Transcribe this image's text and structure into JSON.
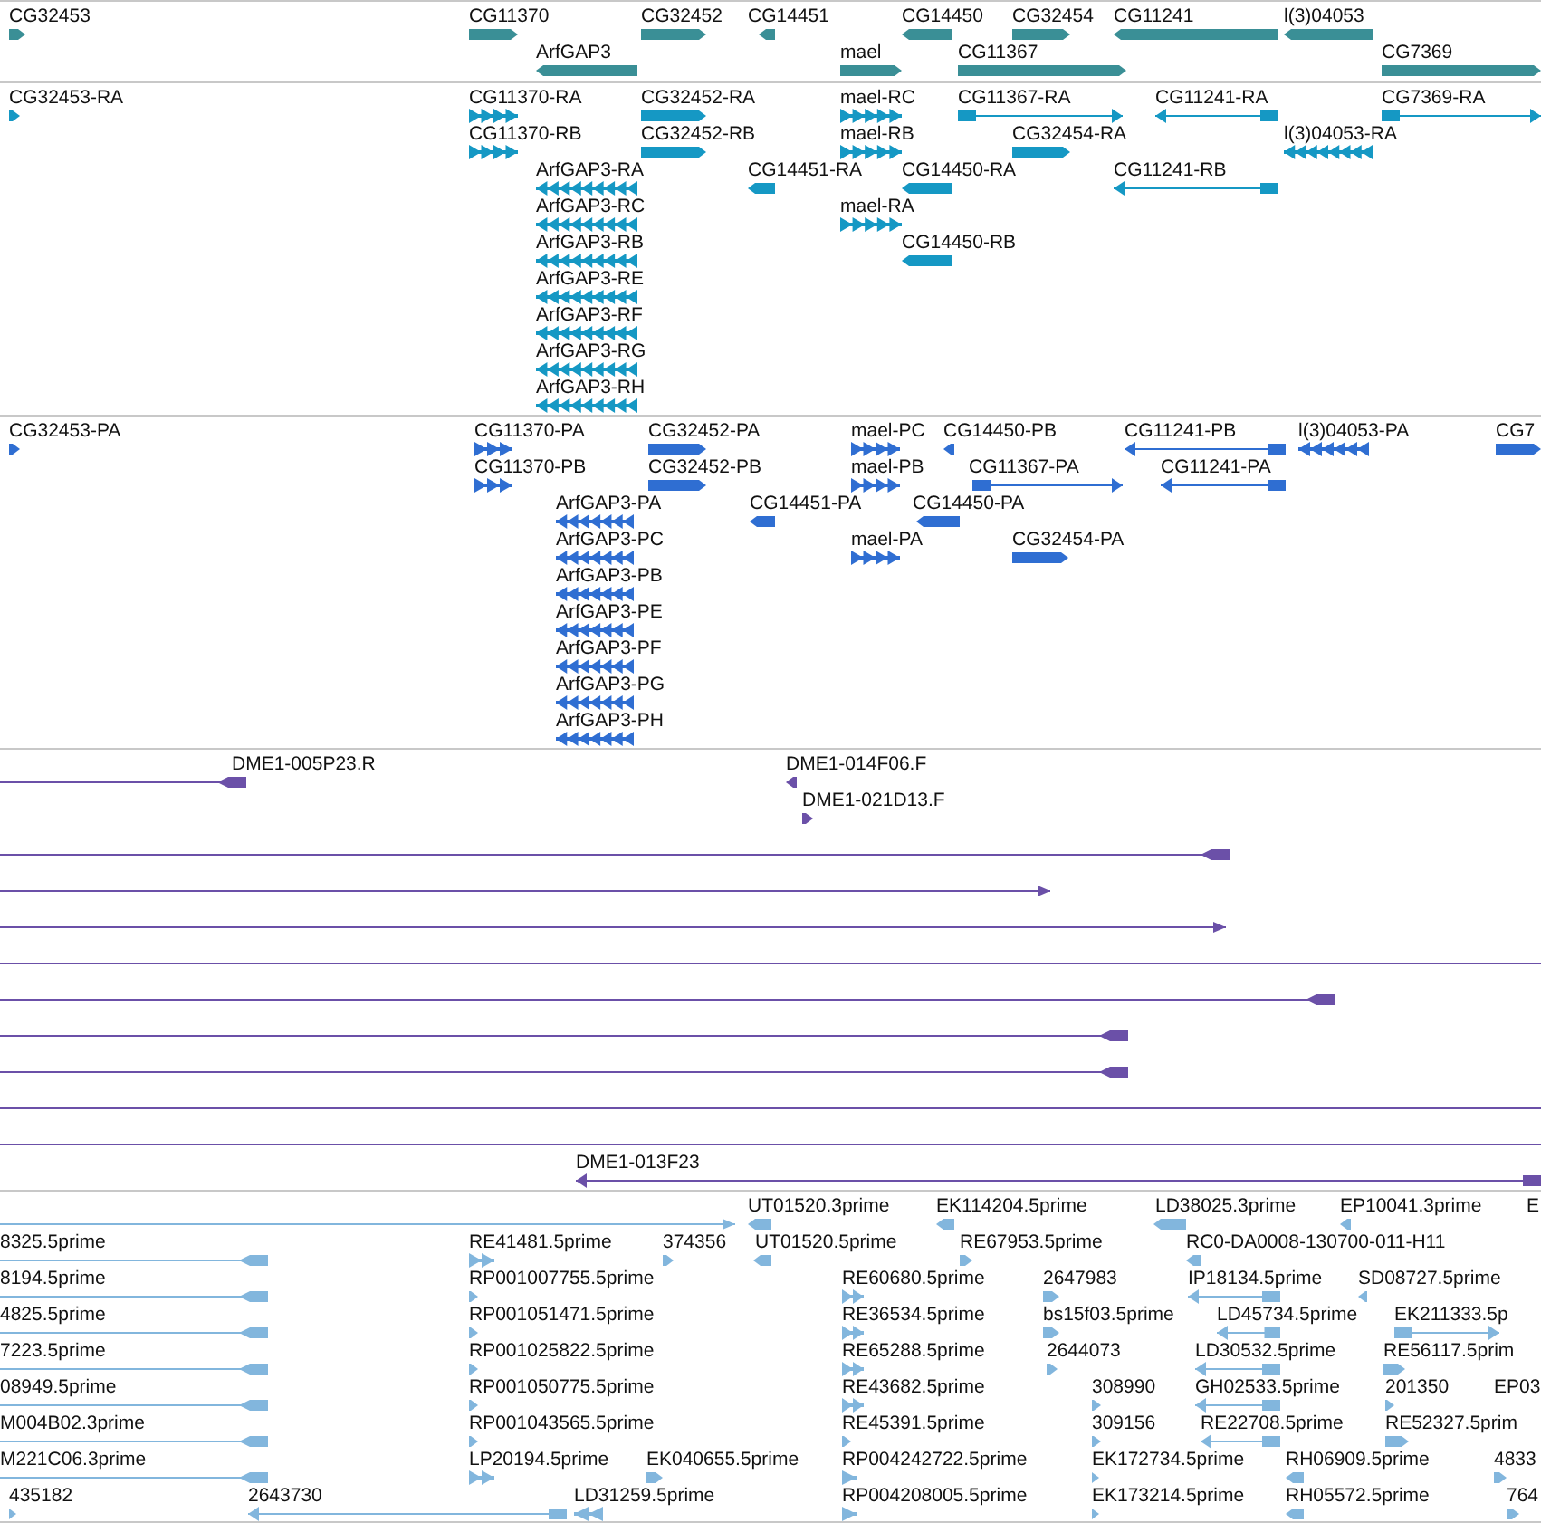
{
  "tracks": [
    {
      "color": "#3a8f96",
      "features": [
        {
          "label": "CG32453",
          "reverse": false
        },
        {
          "label": "CG11370",
          "reverse": false
        },
        {
          "label": "CG32452",
          "reverse": false
        },
        {
          "label": "CG14451",
          "reverse": true
        },
        {
          "label": "CG14450",
          "reverse": true
        },
        {
          "label": "CG32454",
          "reverse": false
        },
        {
          "label": "CG11241",
          "reverse": true
        },
        {
          "label": "l(3)04053",
          "reverse": true
        },
        {
          "label": "ArfGAP3",
          "reverse": true
        },
        {
          "label": "mael",
          "reverse": false
        },
        {
          "label": "CG11367",
          "reverse": false
        },
        {
          "label": "CG7369",
          "reverse": false
        }
      ]
    },
    {
      "color": "#1598c4",
      "features": [
        {
          "label": "CG32453-RA",
          "reverse": false
        },
        {
          "label": "CG11370-RA",
          "reverse": false
        },
        {
          "label": "CG32452-RA",
          "reverse": false
        },
        {
          "label": "mael-RC",
          "reverse": false
        },
        {
          "label": "CG11367-RA",
          "reverse": false
        },
        {
          "label": "CG11241-RA",
          "reverse": true
        },
        {
          "label": "CG7369-RA",
          "reverse": false
        },
        {
          "label": "CG11370-RB",
          "reverse": false
        },
        {
          "label": "CG32452-RB",
          "reverse": false
        },
        {
          "label": "mael-RB",
          "reverse": false
        },
        {
          "label": "CG32454-RA",
          "reverse": false
        },
        {
          "label": "l(3)04053-RA",
          "reverse": true
        },
        {
          "label": "ArfGAP3-RA",
          "reverse": true
        },
        {
          "label": "CG14451-RA",
          "reverse": true
        },
        {
          "label": "CG14450-RA",
          "reverse": true
        },
        {
          "label": "CG11241-RB",
          "reverse": true
        },
        {
          "label": "ArfGAP3-RC",
          "reverse": true
        },
        {
          "label": "mael-RA",
          "reverse": false
        },
        {
          "label": "ArfGAP3-RB",
          "reverse": true
        },
        {
          "label": "CG14450-RB",
          "reverse": true
        },
        {
          "label": "ArfGAP3-RE",
          "reverse": true
        },
        {
          "label": "ArfGAP3-RF",
          "reverse": true
        },
        {
          "label": "ArfGAP3-RG",
          "reverse": true
        },
        {
          "label": "ArfGAP3-RH",
          "reverse": true
        }
      ]
    },
    {
      "color": "#2f6ed2",
      "features": [
        {
          "label": "CG32453-PA",
          "reverse": false
        },
        {
          "label": "CG11370-PA",
          "reverse": false
        },
        {
          "label": "CG32452-PA",
          "reverse": false
        },
        {
          "label": "mael-PC",
          "reverse": false
        },
        {
          "label": "CG14450-PB",
          "reverse": true
        },
        {
          "label": "CG11241-PB",
          "reverse": true
        },
        {
          "label": "l(3)04053-PA",
          "reverse": true
        },
        {
          "label": "CG7",
          "reverse": false
        },
        {
          "label": "CG11370-PB",
          "reverse": false
        },
        {
          "label": "CG32452-PB",
          "reverse": false
        },
        {
          "label": "mael-PB",
          "reverse": false
        },
        {
          "label": "CG11367-PA",
          "reverse": false
        },
        {
          "label": "CG11241-PA",
          "reverse": true
        },
        {
          "label": "ArfGAP3-PA",
          "reverse": true
        },
        {
          "label": "CG14451-PA",
          "reverse": true
        },
        {
          "label": "CG14450-PA",
          "reverse": true
        },
        {
          "label": "ArfGAP3-PC",
          "reverse": true
        },
        {
          "label": "mael-PA",
          "reverse": false
        },
        {
          "label": "CG32454-PA",
          "reverse": false
        },
        {
          "label": "ArfGAP3-PB",
          "reverse": true
        },
        {
          "label": "ArfGAP3-PE",
          "reverse": true
        },
        {
          "label": "ArfGAP3-PF",
          "reverse": true
        },
        {
          "label": "ArfGAP3-PG",
          "reverse": true
        },
        {
          "label": "ArfGAP3-PH",
          "reverse": true
        }
      ]
    },
    {
      "color": "#6b50a8",
      "features": [
        {
          "label": "DME1-005P23.R",
          "reverse": true
        },
        {
          "label": "DME1-014F06.F",
          "reverse": true
        },
        {
          "label": "DME1-021D13.F",
          "reverse": false
        },
        {
          "reverse": true
        },
        {
          "reverse": false
        },
        {
          "reverse": false
        },
        {
          "kind": "span"
        },
        {
          "reverse": true
        },
        {
          "reverse": true
        },
        {
          "reverse": true
        },
        {
          "kind": "span"
        },
        {
          "kind": "span"
        },
        {
          "label": "DME1-013F23",
          "reverse": true
        }
      ]
    },
    {
      "color": "#82b6dd",
      "features": [
        {
          "reverse": false
        },
        {
          "label": "UT01520.3prime",
          "reverse": true
        },
        {
          "label": "EK114204.5prime",
          "reverse": true
        },
        {
          "label": "LD38025.3prime",
          "reverse": true
        },
        {
          "label": "EP10041.3prime",
          "reverse": true
        },
        {
          "label": "E"
        },
        {
          "label": "8325.5prime",
          "reverse": true
        },
        {
          "label": "RE41481.5prime",
          "reverse": false
        },
        {
          "label": "374356",
          "reverse": false
        },
        {
          "label": "UT01520.5prime",
          "reverse": true
        },
        {
          "label": "RE67953.5prime",
          "reverse": false
        },
        {
          "label": "RC0-DA0008-130700-011-H11",
          "reverse": true
        },
        {
          "label": "8194.5prime",
          "reverse": true
        },
        {
          "label": "RP001007755.5prime",
          "reverse": false
        },
        {
          "label": "RE60680.5prime",
          "reverse": false
        },
        {
          "label": "2647983",
          "reverse": false
        },
        {
          "label": "IP18134.5prime",
          "reverse": true
        },
        {
          "label": "SD08727.5prime",
          "reverse": true
        },
        {
          "label": "4825.5prime",
          "reverse": true
        },
        {
          "label": "RP001051471.5prime",
          "reverse": false
        },
        {
          "label": "RE36534.5prime",
          "reverse": false
        },
        {
          "label": "bs15f03.5prime",
          "reverse": false
        },
        {
          "label": "LD45734.5prime",
          "reverse": true
        },
        {
          "label": "EK211333.5p",
          "reverse": false
        },
        {
          "label": "7223.5prime",
          "reverse": true
        },
        {
          "label": "RP001025822.5prime",
          "reverse": false
        },
        {
          "label": "RE65288.5prime",
          "reverse": false
        },
        {
          "label": "2644073",
          "reverse": false
        },
        {
          "label": "LD30532.5prime",
          "reverse": true
        },
        {
          "label": "RE56117.5prim",
          "reverse": false
        },
        {
          "label": "08949.5prime",
          "reverse": true
        },
        {
          "label": "RP001050775.5prime",
          "reverse": false
        },
        {
          "label": "RE43682.5prime",
          "reverse": false
        },
        {
          "label": "308990",
          "reverse": false
        },
        {
          "label": "GH02533.5prime",
          "reverse": true
        },
        {
          "label": "201350",
          "reverse": false
        },
        {
          "label": "EP03"
        },
        {
          "label": "M004B02.3prime",
          "reverse": true
        },
        {
          "label": "RP001043565.5prime",
          "reverse": false
        },
        {
          "label": "RE45391.5prime",
          "reverse": false
        },
        {
          "label": "309156",
          "reverse": false
        },
        {
          "label": "RE22708.5prime",
          "reverse": true
        },
        {
          "label": "RE52327.5prim",
          "reverse": false
        },
        {
          "label": "M221C06.3prime",
          "reverse": true
        },
        {
          "label": "LP20194.5prime",
          "reverse": false
        },
        {
          "label": "EK040655.5prime",
          "reverse": false
        },
        {
          "label": "RP004242722.5prime",
          "reverse": false
        },
        {
          "label": "EK172734.5prime",
          "reverse": false
        },
        {
          "label": "RH06909.5prime",
          "reverse": true
        },
        {
          "label": "4833",
          "reverse": false
        },
        {
          "label": "435182",
          "reverse": false
        },
        {
          "label": "2643730",
          "reverse": true
        },
        {
          "label": "LD31259.5prime",
          "reverse": true
        },
        {
          "label": "RP004208005.5prime",
          "reverse": false
        },
        {
          "label": "EK173214.5prime",
          "reverse": false
        },
        {
          "label": "RH05572.5prime",
          "reverse": true
        },
        {
          "label": "764",
          "reverse": false
        }
      ]
    }
  ]
}
